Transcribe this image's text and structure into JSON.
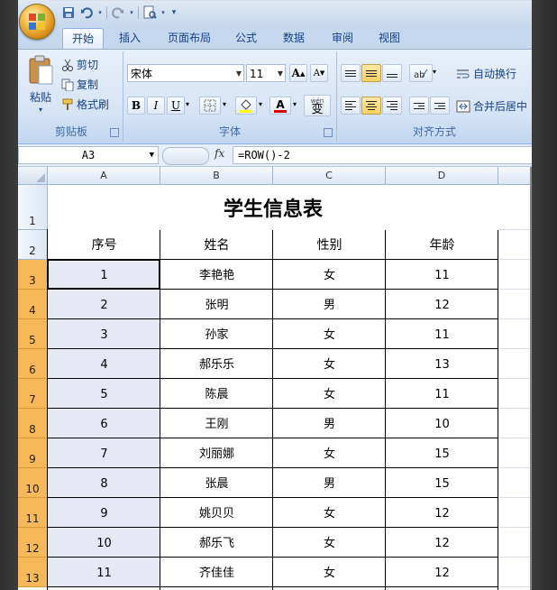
{
  "qat": {
    "icons": [
      "save-icon",
      "undo-icon",
      "redo-icon",
      "print-preview-icon",
      "customize-icon"
    ]
  },
  "tabs": [
    "开始",
    "插入",
    "页面布局",
    "公式",
    "数据",
    "审阅",
    "视图"
  ],
  "active_tab": "开始",
  "ribbon": {
    "clipboard": {
      "paste_label": "粘贴",
      "cut": "剪切",
      "copy": "复制",
      "format_painter": "格式刷",
      "group_label": "剪贴板"
    },
    "font": {
      "font_name": "宋体",
      "font_size": "11",
      "bold": "B",
      "italic": "I",
      "underline": "U",
      "font_color_letter": "A",
      "wen_label": "wén",
      "wen_char": "变",
      "group_label": "字体",
      "grow_label": "A",
      "shrink_label": "A"
    },
    "alignment": {
      "wrap_text": "自动换行",
      "merge_center": "合并后居中",
      "group_label": "对齐方式"
    }
  },
  "formula_bar": {
    "name_box": "A3",
    "fx": "fx",
    "formula": "=ROW()-2"
  },
  "columns": [
    "A",
    "B",
    "C",
    "D"
  ],
  "rows": [
    "1",
    "2",
    "3",
    "4",
    "5",
    "6",
    "7",
    "8",
    "9",
    "10",
    "11",
    "12",
    "13"
  ],
  "sheet": {
    "title": "学生信息表",
    "headers": [
      "序号",
      "姓名",
      "性别",
      "年龄"
    ],
    "records": [
      [
        "1",
        "李艳艳",
        "女",
        "11"
      ],
      [
        "2",
        "张明",
        "男",
        "12"
      ],
      [
        "3",
        "孙家",
        "女",
        "11"
      ],
      [
        "4",
        "郝乐乐",
        "女",
        "13"
      ],
      [
        "5",
        "陈晨",
        "女",
        "11"
      ],
      [
        "6",
        "王刚",
        "男",
        "10"
      ],
      [
        "7",
        "刘丽娜",
        "女",
        "15"
      ],
      [
        "8",
        "张晨",
        "男",
        "15"
      ],
      [
        "9",
        "姚贝贝",
        "女",
        "12"
      ],
      [
        "10",
        "郝乐飞",
        "女",
        "12"
      ],
      [
        "11",
        "齐佳佳",
        "女",
        "12"
      ]
    ]
  },
  "colors": {
    "selected_row_header": "#f7b85a",
    "selected_cell": "#e6e8f3",
    "ribbon": "#d4e3f5"
  }
}
